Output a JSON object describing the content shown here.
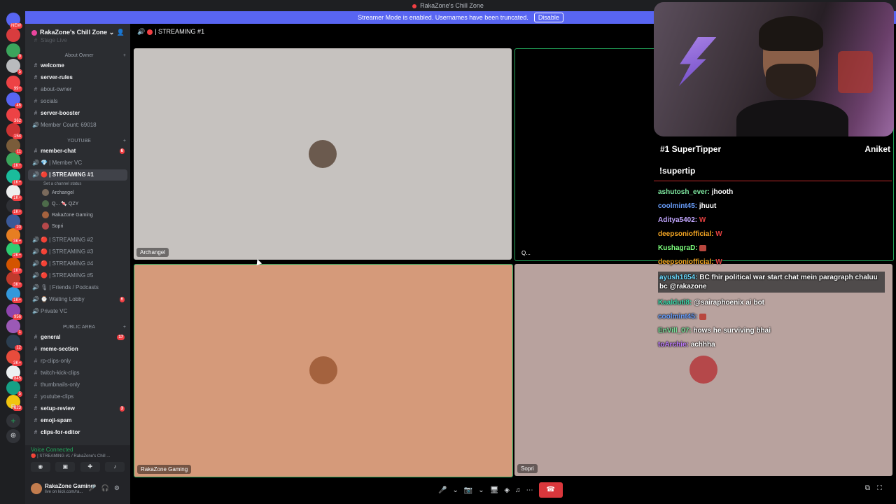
{
  "window": {
    "title": "RakaZone's Chill Zone"
  },
  "banner": {
    "text": "Streamer Mode is enabled. Usernames have been truncated.",
    "button": "Disable"
  },
  "guilds": [
    {
      "color": "#5865f2",
      "badge": "NEW"
    },
    {
      "color": "#d83c3e",
      "badge": ""
    },
    {
      "color": "#3ba55c",
      "badge": "9"
    },
    {
      "color": "#b9bbbe",
      "badge": "5"
    },
    {
      "color": "#ed4245",
      "badge": "99+"
    },
    {
      "color": "#5865f2",
      "badge": "46"
    },
    {
      "color": "#ed4245",
      "badge": "362"
    },
    {
      "color": "#cc3333",
      "badge": "154"
    },
    {
      "color": "#7a5c3a",
      "badge": "11"
    },
    {
      "color": "#3ba55c",
      "badge": "1K+"
    },
    {
      "color": "#1abc9c",
      "badge": "1K+"
    },
    {
      "color": "#eeeeee",
      "badge": "1K+"
    },
    {
      "color": "#2f3136",
      "badge": "1K+"
    },
    {
      "color": "#3b5998",
      "badge": "20"
    },
    {
      "color": "#e67e22",
      "badge": "3K+"
    },
    {
      "color": "#2ecc71",
      "badge": "2K+"
    },
    {
      "color": "#d35400",
      "badge": "1K+"
    },
    {
      "color": "#c0392b",
      "badge": "3K+"
    },
    {
      "color": "#3498db",
      "badge": "1K+"
    },
    {
      "color": "#8e44ad",
      "badge": "956"
    },
    {
      "color": "#9b59b6",
      "badge": "1"
    },
    {
      "color": "#2c3e50",
      "badge": "12"
    },
    {
      "color": "#e74c3c",
      "badge": "3K+"
    },
    {
      "color": "#ecf0f1",
      "badge": "845"
    },
    {
      "color": "#16a085",
      "badge": "5"
    },
    {
      "color": "#f1c40f",
      "badge": "823"
    }
  ],
  "guild_extras": {
    "r": "R",
    "add": "+",
    "discover": "⊕"
  },
  "sidebar": {
    "server_name": "RakaZone's Chill Zone",
    "stage_line": "Stage Live",
    "categories": [
      "About Owner",
      "YOUTUBE",
      "PUBLIC AREA"
    ],
    "channels_top": [
      {
        "label": "welcome",
        "icon": "#",
        "bold": true
      },
      {
        "label": "server-rules",
        "icon": "#",
        "bold": true
      },
      {
        "label": "about-owner",
        "icon": "#",
        "bold": false
      },
      {
        "label": "socials",
        "icon": "#",
        "bold": false
      },
      {
        "label": "server-booster",
        "icon": "#",
        "bold": true
      },
      {
        "label": "Member Count: 69018",
        "icon": "🔊",
        "bold": false
      }
    ],
    "channels_yt": [
      {
        "label": "member-chat",
        "icon": "#",
        "bold": true,
        "badge": "6"
      },
      {
        "label": "💎 | Member VC",
        "icon": "🔊",
        "bold": false,
        "badge": ""
      },
      {
        "label": "🔴 | STREAMING #1",
        "icon": "🔊",
        "bold": true,
        "badge": "",
        "active": true
      }
    ],
    "streaming_status": "Set a channel status",
    "voice_users": [
      "Archangel",
      "Q... 🍬 QZY",
      "RakaZone Gaming",
      "Sopri"
    ],
    "channels_stream": [
      {
        "label": "🔴 | STREAMING #2",
        "badge": ""
      },
      {
        "label": "🔴 | STREAMING #3",
        "badge": ""
      },
      {
        "label": "🔴 | STREAMING #4",
        "badge": ""
      },
      {
        "label": "🔴 | STREAMING #5",
        "badge": ""
      },
      {
        "label": "🎙 | Friends / Podcasts",
        "badge": ""
      },
      {
        "label": "⌚ Waiting Lobby",
        "badge": "6"
      },
      {
        "label": "Private VC",
        "badge": ""
      }
    ],
    "channels_public": [
      {
        "label": "general",
        "bold": true,
        "badge": "17"
      },
      {
        "label": "meme-section",
        "bold": true,
        "badge": ""
      },
      {
        "label": "rp-clips-only",
        "bold": false,
        "badge": ""
      },
      {
        "label": "twitch-kick-clips",
        "bold": false,
        "badge": ""
      },
      {
        "label": "thumbnails-only",
        "bold": false,
        "badge": ""
      },
      {
        "label": "youtube-clips",
        "bold": false,
        "badge": ""
      },
      {
        "label": "setup-review",
        "bold": true,
        "badge": "3"
      },
      {
        "label": "emoji-spam",
        "bold": true,
        "badge": ""
      },
      {
        "label": "clips-for-editor",
        "bold": true,
        "badge": ""
      }
    ],
    "voice_connected": "Voice Connected",
    "voice_sub": "🔴 | STREAMING #1 / RakaZone's Chill ...",
    "username": "RakaZone Gaming",
    "user_status": "live on kick.com/ra..."
  },
  "stage": {
    "header": "| STREAMING #1",
    "tiles": [
      {
        "name": "Archangel",
        "bg": "#c6c2bf",
        "avatar": "#6b5a4e"
      },
      {
        "name": "Q...",
        "bg": "#000000",
        "avatar": ""
      },
      {
        "name": "RakaZone Gaming",
        "bg": "#d59a7a",
        "avatar": "#a4623e"
      },
      {
        "name": "Sopri",
        "bg": "#b8a29e",
        "avatar": "#b5484a"
      }
    ],
    "controls": {
      "mic": "🎤",
      "camera": "📷",
      "screen": "🖥",
      "activities": "◈",
      "soundboard": "♫",
      "more": "⋯",
      "hangup": "☎"
    }
  },
  "overlay": {
    "tipper_rank": "#1 SuperTipper",
    "tipper_name": "Aniket",
    "command": "!supertip",
    "chat": [
      {
        "user": "ashutosh_ever:",
        "text": "jhooth",
        "color": "#7ee8a0",
        "emote": false,
        "w": false,
        "hl": false
      },
      {
        "user": "coolmint45:",
        "text": "jhuut",
        "color": "#6aa0ff",
        "emote": false,
        "w": false,
        "hl": false
      },
      {
        "user": "Aditya5402:",
        "text": "W",
        "color": "#c2a6ff",
        "emote": false,
        "w": true,
        "hl": false
      },
      {
        "user": "deepsoniofficial:",
        "text": "W",
        "color": "#f5a623",
        "emote": false,
        "w": true,
        "hl": false
      },
      {
        "user": "KushagraD:",
        "text": "",
        "color": "#7cff7c",
        "emote": true,
        "w": false,
        "hl": false
      },
      {
        "user": "deepsoniofficial:",
        "text": "W",
        "color": "#f5a623",
        "emote": false,
        "w": true,
        "hl": false
      },
      {
        "user": "ayush1654:",
        "text": "BC fhir political war start chat mein paragraph chaluu bc @rakazone",
        "color": "#6bdcff",
        "emote": false,
        "w": false,
        "hl": true
      },
      {
        "user": "Kaalduti8:",
        "text": "@sairaphoenix ai bot",
        "color": "#3fe0b0",
        "emote": false,
        "w": false,
        "hl": false
      },
      {
        "user": "coolmint45:",
        "text": "",
        "color": "#6aa0ff",
        "emote": true,
        "w": false,
        "hl": false
      },
      {
        "user": "EnVill_07:",
        "text": "hows he surviving bhai",
        "color": "#7ee8a0",
        "emote": false,
        "w": false,
        "hl": false
      },
      {
        "user": "toArchie:",
        "text": "achhha",
        "color": "#c07cff",
        "emote": false,
        "w": false,
        "hl": false
      }
    ]
  }
}
